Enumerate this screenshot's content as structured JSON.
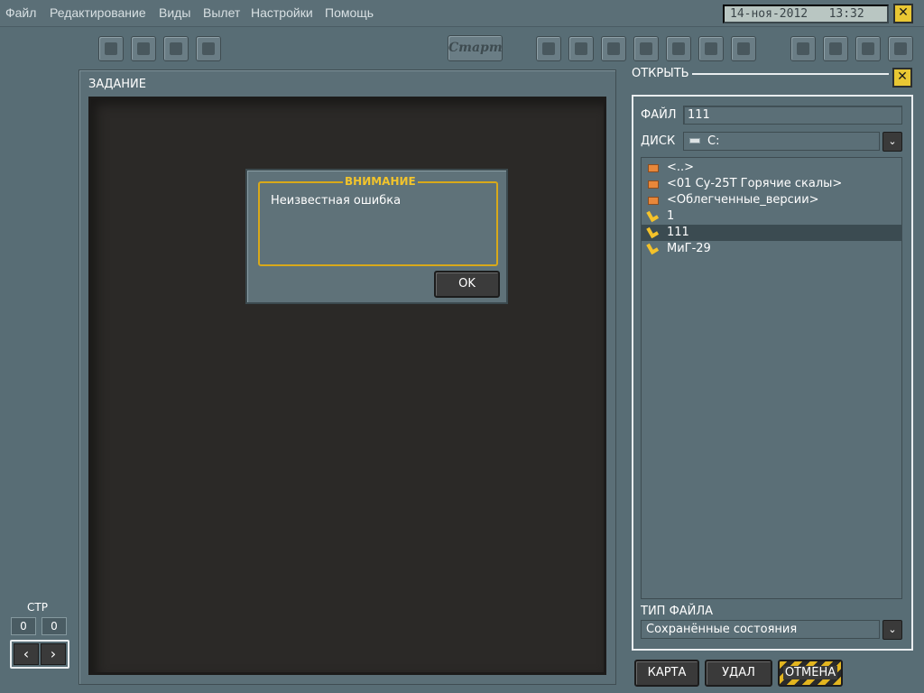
{
  "menu": {
    "items": [
      "Файл",
      "Редактирование",
      "Виды",
      "Вылет",
      "Настройки",
      "Помощь"
    ]
  },
  "clock": {
    "date": "14-ноя-2012",
    "time": "13:32"
  },
  "window": {
    "close_glyph": "✕"
  },
  "toolbar": {
    "start_label": "Старт",
    "icons": [
      "new-icon",
      "open-icon",
      "save-icon",
      "delete-icon",
      "map-icon",
      "briefing-icon",
      "list-icon",
      "globe-icon",
      "target-icon",
      "book-icon",
      "sound-icon",
      "pilot-icon",
      "compass-icon",
      "plane-icon",
      "net-icon"
    ]
  },
  "task": {
    "title": "ЗАДАНИЕ"
  },
  "dialog": {
    "title": "ВНИМАНИЕ",
    "message": "Неизвестная ошибка",
    "ok_label": "OK"
  },
  "pager": {
    "label": "СТР",
    "left_value": "0",
    "right_value": "0",
    "prev_glyph": "‹",
    "next_glyph": "›"
  },
  "open": {
    "title": "ОТКРЫТЬ",
    "file_label": "ФАЙЛ",
    "file_value": "111",
    "disk_label": "ДИСК",
    "disk_value": "C:",
    "files": [
      {
        "name": "<..>",
        "kind": "folder",
        "selected": false
      },
      {
        "name": "<01 Су-25Т Горячие скалы>",
        "kind": "folder",
        "selected": false
      },
      {
        "name": "<Облегченные_версии>",
        "kind": "folder",
        "selected": false
      },
      {
        "name": "1",
        "kind": "state",
        "selected": false
      },
      {
        "name": "111",
        "kind": "state",
        "selected": true
      },
      {
        "name": "МиГ-29",
        "kind": "state",
        "selected": false
      }
    ],
    "type_label": "ТИП ФАЙЛА",
    "type_value": "Сохранённые состояния"
  },
  "buttons": {
    "map": "КАРТА",
    "delete": "УДАЛ",
    "cancel": "ОТМЕНА"
  },
  "colors": {
    "accent": "#e9c733",
    "panel": "#586d75",
    "dark": "#2b2927"
  }
}
